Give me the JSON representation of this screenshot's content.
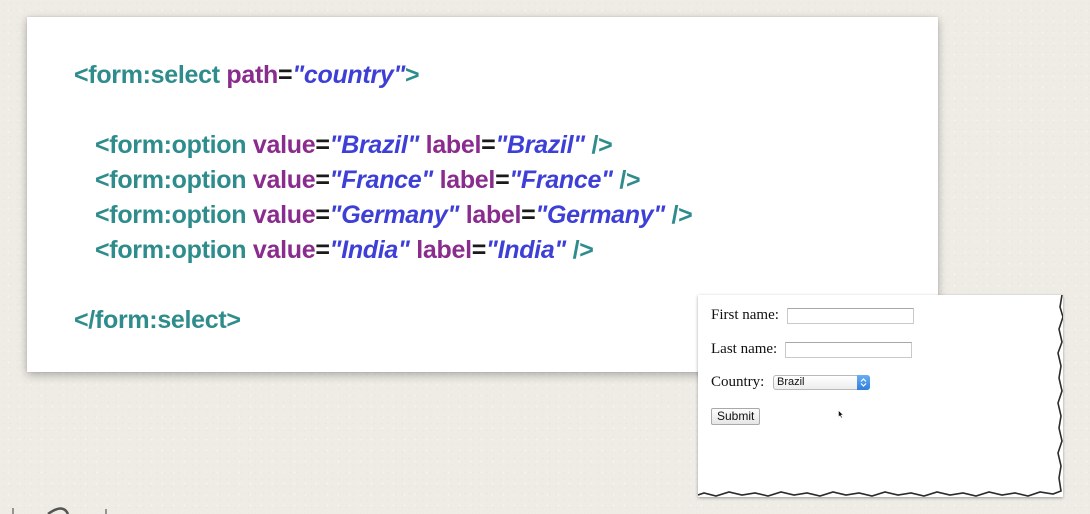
{
  "code": {
    "select_open": {
      "tag_open": "<form:select ",
      "attr_name": "path",
      "eq": "=",
      "attr_value": "\"country\"",
      "tag_close": ">"
    },
    "options": [
      {
        "tag_open": "<form:option ",
        "value_name": "value",
        "eq1": "=",
        "value_value": "\"Brazil\"",
        "label_name": " label",
        "eq2": "=",
        "label_value": "\"Brazil\"",
        "tag_close": " />"
      },
      {
        "tag_open": "<form:option ",
        "value_name": "value",
        "eq1": "=",
        "value_value": "\"France\"",
        "label_name": " label",
        "eq2": "=",
        "label_value": "\"France\"",
        "tag_close": " />"
      },
      {
        "tag_open": "<form:option ",
        "value_name": "value",
        "eq1": "=",
        "value_value": "\"Germany\"",
        "label_name": " label",
        "eq2": "=",
        "label_value": "\"Germany\"",
        "tag_close": " />"
      },
      {
        "tag_open": "<form:option ",
        "value_name": "value",
        "eq1": "=",
        "value_value": "\"India\"",
        "label_name": " label",
        "eq2": "=",
        "label_value": "\"India\"",
        "tag_close": " />"
      }
    ],
    "select_close": "</form:select>"
  },
  "form_preview": {
    "first_name_label": "First name:",
    "first_name_value": "",
    "last_name_label": "Last name:",
    "last_name_value": "",
    "country_label": "Country:",
    "country_selected": "Brazil",
    "submit_label": "Submit"
  },
  "colors": {
    "tag": "#2f8c8c",
    "attribute": "#8a2b8e",
    "string": "#3d3fd6",
    "select_arrow": "#2f7fe0"
  },
  "icons": {
    "select_arrow": "chevron-up-down-icon",
    "cursor": "mouse-pointer-icon",
    "corner": "curve-mark-icon"
  }
}
